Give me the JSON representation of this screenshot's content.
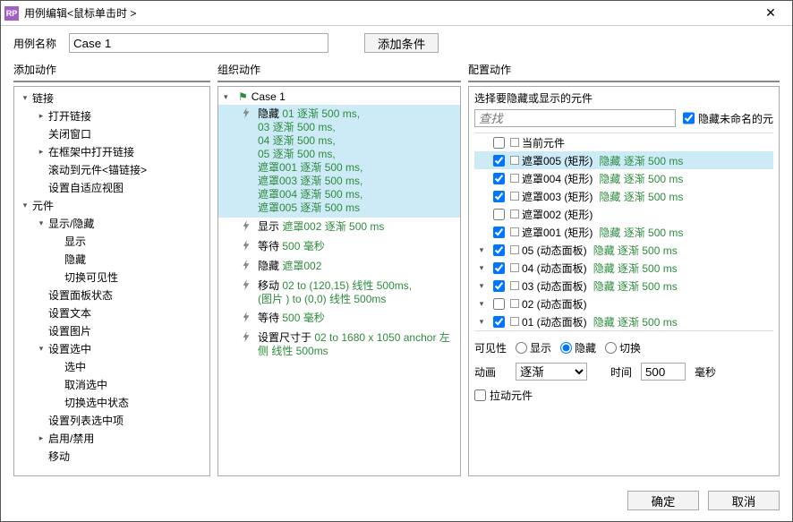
{
  "window": {
    "title": "用例编辑<鼠标单击时 >",
    "close_glyph": "✕"
  },
  "top": {
    "name_label": "用例名称",
    "name_value": "Case 1",
    "add_condition_btn": "添加条件"
  },
  "columns": {
    "add_action": "添加动作",
    "organize_action": "组织动作",
    "config_action": "配置动作"
  },
  "add_tree": [
    {
      "indent": 0,
      "expand": "down",
      "label": "链接"
    },
    {
      "indent": 1,
      "expand": "right",
      "label": "打开链接"
    },
    {
      "indent": 1,
      "expand": "",
      "label": "关闭窗口"
    },
    {
      "indent": 1,
      "expand": "right",
      "label": "在框架中打开链接"
    },
    {
      "indent": 1,
      "expand": "",
      "label": "滚动到元件<锚链接>"
    },
    {
      "indent": 1,
      "expand": "",
      "label": "设置自适应视图"
    },
    {
      "indent": 0,
      "expand": "down",
      "label": "元件"
    },
    {
      "indent": 1,
      "expand": "down",
      "label": "显示/隐藏"
    },
    {
      "indent": 2,
      "expand": "",
      "label": "显示"
    },
    {
      "indent": 2,
      "expand": "",
      "label": "隐藏"
    },
    {
      "indent": 2,
      "expand": "",
      "label": "切换可见性"
    },
    {
      "indent": 1,
      "expand": "",
      "label": "设置面板状态"
    },
    {
      "indent": 1,
      "expand": "",
      "label": "设置文本"
    },
    {
      "indent": 1,
      "expand": "",
      "label": "设置图片"
    },
    {
      "indent": 1,
      "expand": "down",
      "label": "设置选中"
    },
    {
      "indent": 2,
      "expand": "",
      "label": "选中"
    },
    {
      "indent": 2,
      "expand": "",
      "label": "取消选中"
    },
    {
      "indent": 2,
      "expand": "",
      "label": "切换选中状态"
    },
    {
      "indent": 1,
      "expand": "",
      "label": "设置列表选中项"
    },
    {
      "indent": 1,
      "expand": "right",
      "label": "启用/禁用"
    },
    {
      "indent": 1,
      "expand": "",
      "label": "移动"
    }
  ],
  "org": {
    "root_label": "Case 1",
    "items": [
      {
        "selected": true,
        "lead": "隐藏 ",
        "green": "01 逐渐 500 ms,\n03 逐渐 500 ms,\n04 逐渐 500 ms,\n05 逐渐 500 ms,\n遮罩001 逐渐 500 ms,\n遮罩003 逐渐 500 ms,\n遮罩004 逐渐 500 ms,\n遮罩005 逐渐 500 ms"
      },
      {
        "selected": false,
        "lead": "显示 ",
        "green": "遮罩002 逐渐 500 ms"
      },
      {
        "selected": false,
        "lead": "等待 ",
        "green": "500 毫秒"
      },
      {
        "selected": false,
        "lead": "隐藏 ",
        "green": "遮罩002"
      },
      {
        "selected": false,
        "lead": "移动 ",
        "green": "02 to (120,15) 线性 500ms,\n(图片 ) to (0,0) 线性 500ms"
      },
      {
        "selected": false,
        "lead": "等待 ",
        "green": "500 毫秒"
      },
      {
        "selected": false,
        "lead": "设置尺寸于 ",
        "green": "02 to 1680 x 1050 anchor 左侧 线性 500ms"
      }
    ]
  },
  "config": {
    "heading": "选择要隐藏或显示的元件",
    "search_placeholder": "查找",
    "hide_unnamed_label": "隐藏未命名的元",
    "hide_unnamed_checked": true,
    "widgets": [
      {
        "expand": "",
        "checked": false,
        "selected": false,
        "name": "当前元件",
        "suffix": ""
      },
      {
        "expand": "",
        "checked": true,
        "selected": true,
        "name": "遮罩005 (矩形)",
        "suffix": "隐藏 逐渐 500 ms"
      },
      {
        "expand": "",
        "checked": true,
        "selected": false,
        "name": "遮罩004 (矩形)",
        "suffix": "隐藏 逐渐 500 ms"
      },
      {
        "expand": "",
        "checked": true,
        "selected": false,
        "name": "遮罩003 (矩形)",
        "suffix": "隐藏 逐渐 500 ms"
      },
      {
        "expand": "",
        "checked": false,
        "selected": false,
        "name": "遮罩002 (矩形)",
        "suffix": ""
      },
      {
        "expand": "",
        "checked": true,
        "selected": false,
        "name": "遮罩001 (矩形)",
        "suffix": "隐藏 逐渐 500 ms"
      },
      {
        "expand": "down",
        "checked": true,
        "selected": false,
        "name": "05 (动态面板)",
        "suffix": "隐藏 逐渐 500 ms"
      },
      {
        "expand": "down",
        "checked": true,
        "selected": false,
        "name": "04 (动态面板)",
        "suffix": "隐藏 逐渐 500 ms"
      },
      {
        "expand": "down",
        "checked": true,
        "selected": false,
        "name": "03 (动态面板)",
        "suffix": "隐藏 逐渐 500 ms"
      },
      {
        "expand": "down",
        "checked": false,
        "selected": false,
        "name": "02 (动态面板)",
        "suffix": ""
      },
      {
        "expand": "down",
        "checked": true,
        "selected": false,
        "name": "01 (动态面板)",
        "suffix": "隐藏 逐渐 500 ms"
      }
    ],
    "visibility_label": "可见性",
    "vis_show": "显示",
    "vis_hide": "隐藏",
    "vis_toggle": "切换",
    "vis_value": "hide",
    "anim_label": "动画",
    "anim_value": "逐渐",
    "time_label": "时间",
    "time_value": "500",
    "time_unit": "毫秒",
    "drag_label": "拉动元件",
    "drag_checked": false
  },
  "footer": {
    "ok": "确定",
    "cancel": "取消"
  }
}
